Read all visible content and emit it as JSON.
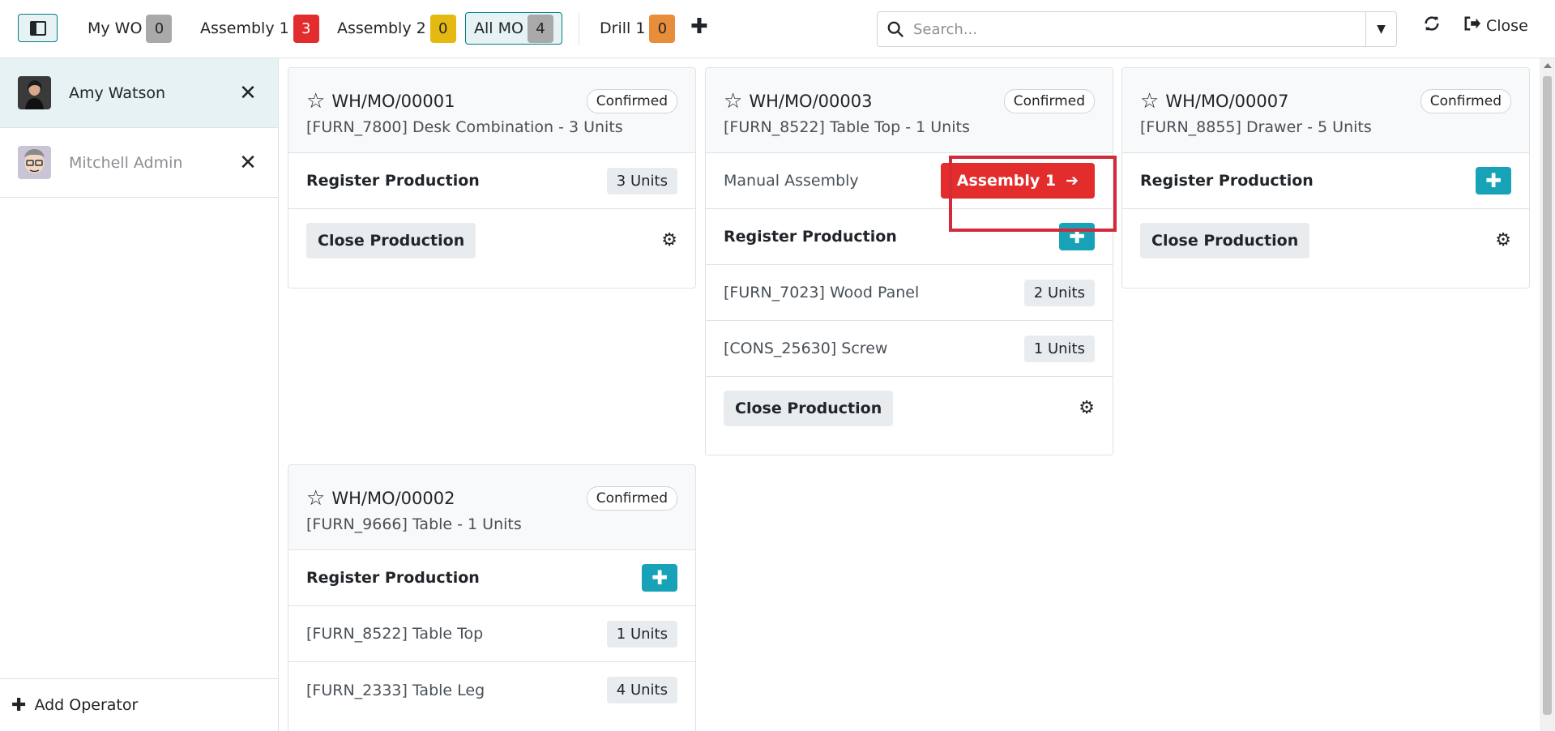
{
  "topbar": {
    "tabs": [
      {
        "label": "My WO",
        "count": "0"
      },
      {
        "label": "Assembly 1",
        "count": "3"
      },
      {
        "label": "Assembly 2",
        "count": "0"
      },
      {
        "label": "All MO",
        "count": "4"
      },
      {
        "label": "Drill 1",
        "count": "0"
      }
    ],
    "search_placeholder": "Search...",
    "close_label": "Close"
  },
  "sidebar": {
    "operators": [
      {
        "name": "Amy Watson"
      },
      {
        "name": "Mitchell Admin"
      }
    ],
    "add_operator": "Add Operator"
  },
  "cards": [
    {
      "name": "WH/MO/00001",
      "state": "Confirmed",
      "product": "[FURN_7800] Desk Combination - 3 Units",
      "register_label": "Register Production",
      "register_units": "3 Units",
      "close_label": "Close Production"
    },
    {
      "name": "WH/MO/00003",
      "state": "Confirmed",
      "product": "[FURN_8522] Table Top - 1 Units",
      "workorder_label": "Manual Assembly",
      "workorder_button": "Assembly 1",
      "register_label": "Register Production",
      "components": [
        {
          "name": "[FURN_7023] Wood Panel",
          "units": "2 Units"
        },
        {
          "name": "[CONS_25630] Screw",
          "units": "1 Units"
        }
      ],
      "close_label": "Close Production"
    },
    {
      "name": "WH/MO/00007",
      "state": "Confirmed",
      "product": "[FURN_8855] Drawer - 5 Units",
      "register_label": "Register Production",
      "close_label": "Close Production"
    },
    {
      "name": "WH/MO/00002",
      "state": "Confirmed",
      "product": "[FURN_9666] Table - 1 Units",
      "register_label": "Register Production",
      "components": [
        {
          "name": "[FURN_8522] Table Top",
          "units": "1 Units"
        },
        {
          "name": "[FURN_2333] Table Leg",
          "units": "4 Units"
        }
      ]
    }
  ]
}
